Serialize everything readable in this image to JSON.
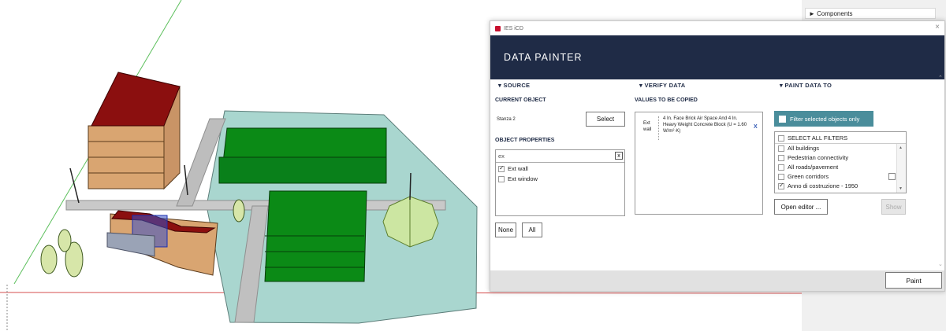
{
  "tray": {
    "components_label": "► Components"
  },
  "dialog": {
    "window_title": "IES iCD",
    "close_glyph": "×",
    "banner_title": "DATA PAINTER",
    "source": {
      "heading": "▾ SOURCE",
      "current_object_label": "CURRENT OBJECT",
      "current_object_value": "Stanza 2",
      "select_button": "Select",
      "object_properties_label": "OBJECT PROPERTIES",
      "filter_value": "ex",
      "clear_glyph": "x",
      "properties": [
        {
          "label": "Ext wall",
          "checked": true
        },
        {
          "label": "Ext window",
          "checked": false
        }
      ],
      "none_button": "None",
      "all_button": "All"
    },
    "verify": {
      "heading": "▾ VERIFY DATA",
      "values_label": "VALUES TO BE COPIED",
      "row_key_line1": "Ext",
      "row_key_line2": "wall",
      "row_value": "4 In. Face Brick Air Space And 4 In. Heavy Weight Concrete Block (U = 1.60 W/m²·K)",
      "remove_glyph": "X"
    },
    "paint": {
      "heading": "▾ PAINT DATA TO",
      "filter_selected_label": "Filter selected objects only",
      "select_all_label": "SELECT ALL FILTERS",
      "filters": [
        {
          "label": "All buildings",
          "checked": false
        },
        {
          "label": "Pedestrian connectivity",
          "checked": false
        },
        {
          "label": "All roads/pavement",
          "checked": false
        },
        {
          "label": "Green corridors",
          "checked": false
        },
        {
          "label": "Anno di costruzione - 1950",
          "checked": true
        }
      ],
      "open_editor_button": "Open editor ...",
      "show_button": "Show"
    },
    "paint_button": "Paint"
  },
  "colors": {
    "banner": "#1f2b46",
    "teal_button": "#4a8d9b",
    "roof_red": "#8b0f0f",
    "green_block": "#0b8a16",
    "site_fill": "#a9d6cf"
  }
}
